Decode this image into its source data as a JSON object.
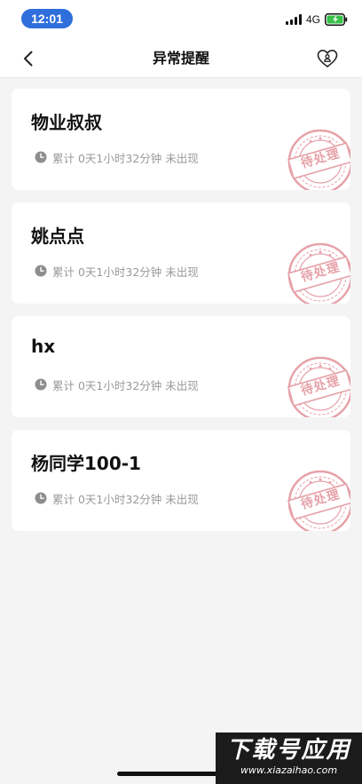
{
  "status_bar": {
    "time": "12:01",
    "network": "4G"
  },
  "nav": {
    "title": "异常提醒",
    "back_icon": "chevron-left-icon",
    "action_icon": "heart-person-icon"
  },
  "alerts": [
    {
      "name": "物业叔叔",
      "info": "累计 0天1小时32分钟 未出现",
      "status": "待处理"
    },
    {
      "name": "姚点点",
      "info": "累计 0天1小时32分钟 未出现",
      "status": "待处理"
    },
    {
      "name": "hx",
      "info": "累计 0天1小时32分钟 未出现",
      "status": "待处理"
    },
    {
      "name": "杨同学100-1",
      "info": "累计 0天1小时32分钟 未出现",
      "status": "待处理"
    }
  ],
  "colors": {
    "accent": "#2f6fdc",
    "stamp": "#e6a2a9",
    "battery": "#37c24a"
  },
  "watermark": {
    "title": "下载号应用",
    "url": "www.xiazaihao.com"
  }
}
